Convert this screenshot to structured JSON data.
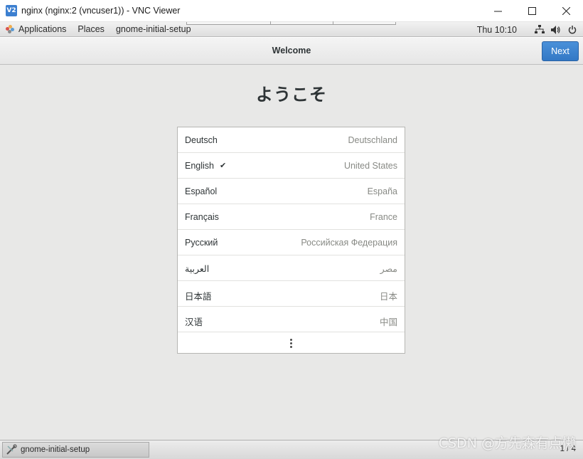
{
  "window": {
    "title": "nginx (nginx:2 (vncuser1)) - VNC Viewer",
    "logo_text": "V2"
  },
  "topbar": {
    "applications": "Applications",
    "places": "Places",
    "app_menu": "gnome-initial-setup",
    "clock": "Thu 10:10",
    "icons": [
      "network-icon",
      "volume-icon",
      "power-icon"
    ]
  },
  "header": {
    "title": "Welcome",
    "next_label": "Next",
    "accent": "#3a7ecb"
  },
  "main": {
    "heading": "ようこそ",
    "languages": [
      {
        "name": "Deutsch",
        "region": "Deutschland",
        "selected": false
      },
      {
        "name": "English",
        "region": "United States",
        "selected": true
      },
      {
        "name": "Español",
        "region": "España",
        "selected": false
      },
      {
        "name": "Français",
        "region": "France",
        "selected": false
      },
      {
        "name": "Русский",
        "region": "Российская Федерация",
        "selected": false
      },
      {
        "name": "العربية",
        "region": "مصر",
        "selected": false
      },
      {
        "name": "日本語",
        "region": "日本",
        "selected": false
      },
      {
        "name": "汉语",
        "region": "中国",
        "selected": false
      }
    ],
    "check_mark": "✔"
  },
  "taskbar": {
    "task_label": "gnome-initial-setup",
    "workspace": "1 / 4"
  },
  "watermark": "CSDN @方先森有点懒"
}
